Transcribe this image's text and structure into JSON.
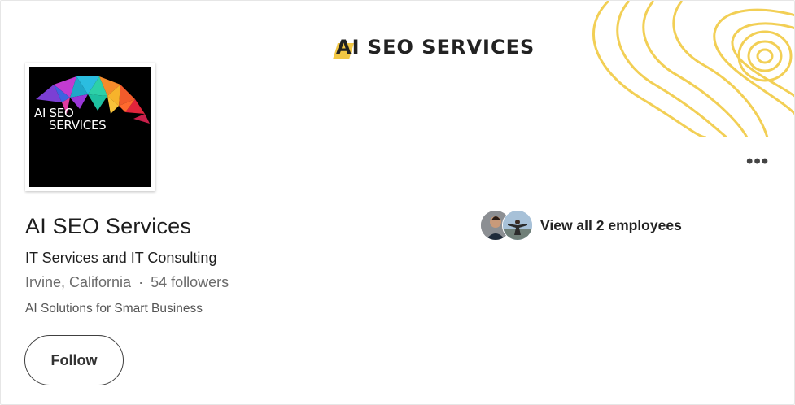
{
  "cover": {
    "logo_text": "AI SEO SERVICES",
    "accent_color": "#f2cf55"
  },
  "logo": {
    "line1": "AI SEO",
    "line2": "SERVICES",
    "background": "#000000"
  },
  "company": {
    "name": "AI SEO Services",
    "industry": "IT Services and IT Consulting",
    "location": "Irvine, California",
    "separator": "·",
    "followers": "54 followers",
    "tagline": "AI Solutions for Smart Business"
  },
  "employees": {
    "label": "View all 2 employees"
  },
  "actions": {
    "follow_label": "Follow",
    "more_icon": "more-horizontal-icon",
    "more_label": "•••"
  }
}
